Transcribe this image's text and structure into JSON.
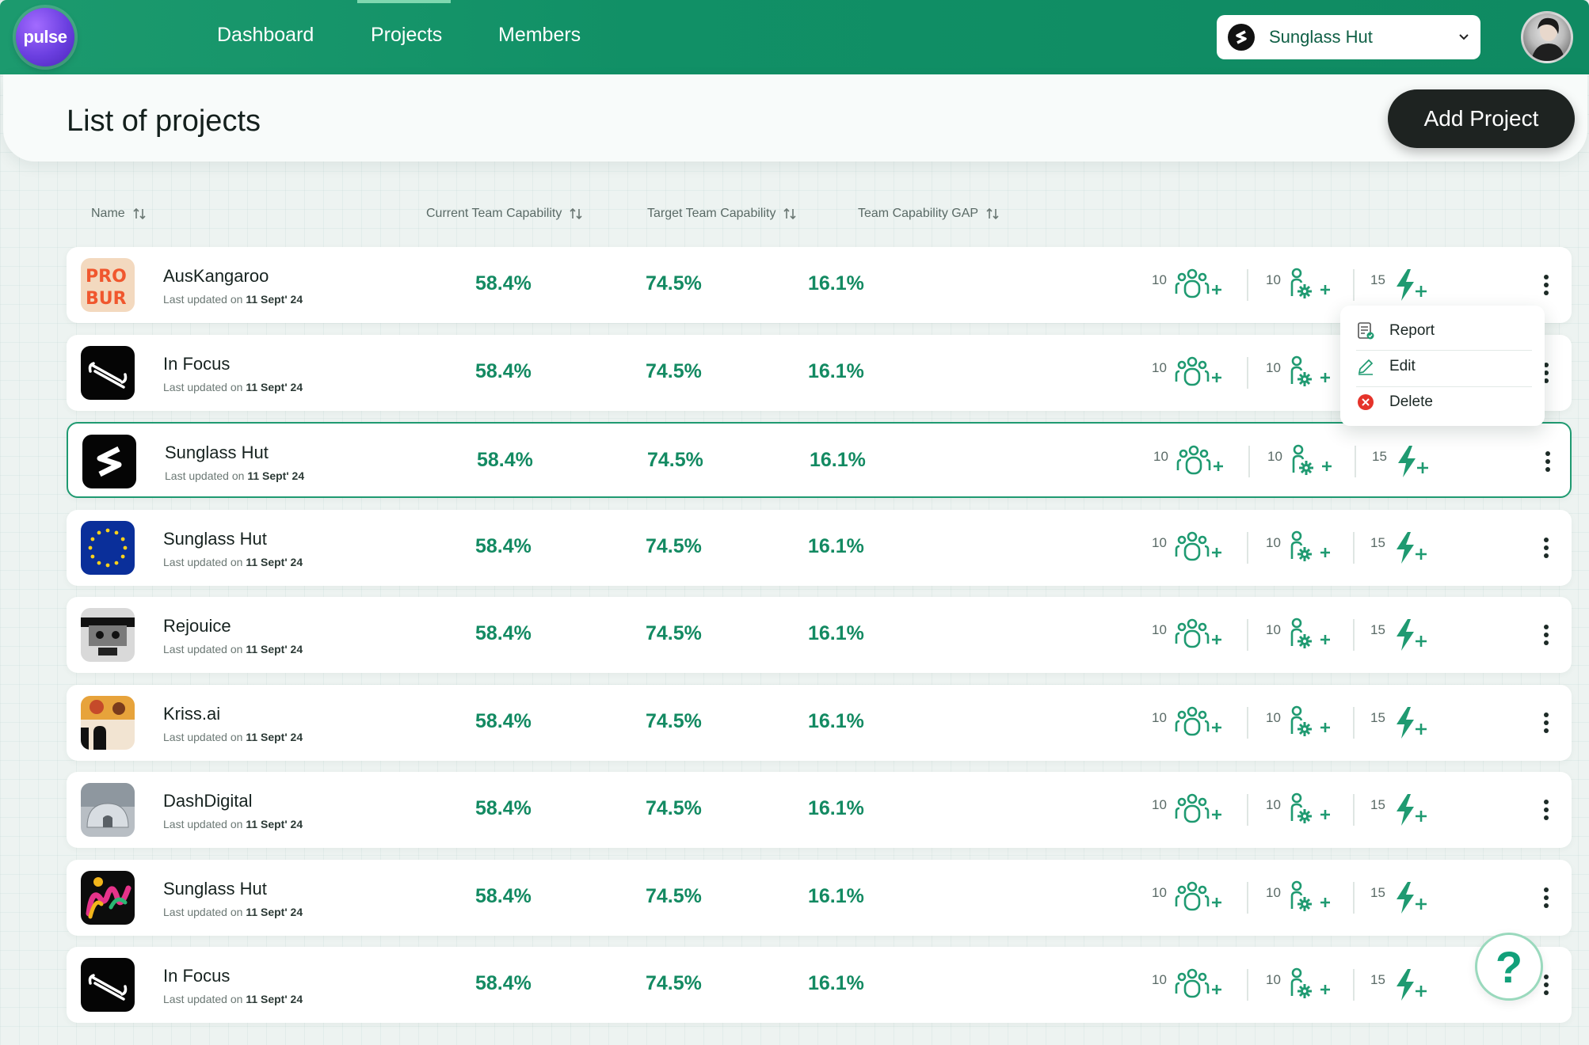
{
  "app": {
    "logo_text": "pulse"
  },
  "nav": {
    "items": [
      {
        "label": "Dashboard"
      },
      {
        "label": "Projects",
        "active": true
      },
      {
        "label": "Members"
      }
    ]
  },
  "org_select": {
    "selected": "Sunglass Hut"
  },
  "page": {
    "title": "List of projects",
    "add_button": "Add Project"
  },
  "columns": {
    "name": "Name",
    "current": "Current Team Capability",
    "target": "Target Team Capability",
    "gap": "Team Capability GAP"
  },
  "colors": {
    "primary": "#138a62",
    "header": "#119066",
    "button_dark": "#1e2321",
    "danger": "#e5332a"
  },
  "rows": [
    {
      "name": "AusKangaroo",
      "updated_prefix": "Last updated on",
      "updated_date": "11 Sept' 24",
      "current": "58.4%",
      "target": "74.5%",
      "gap": "16.1%",
      "members": "10",
      "skills": "10",
      "energy": "15",
      "thumb": "proburn"
    },
    {
      "name": "In Focus",
      "updated_prefix": "Last updated on",
      "updated_date": "11 Sept' 24",
      "current": "58.4%",
      "target": "74.5%",
      "gap": "16.1%",
      "members": "10",
      "skills": "10",
      "energy": "15",
      "thumb": "infocus"
    },
    {
      "name": "Sunglass Hut",
      "updated_prefix": "Last updated on",
      "updated_date": "11 Sept' 24",
      "current": "58.4%",
      "target": "74.5%",
      "gap": "16.1%",
      "members": "10",
      "skills": "10",
      "energy": "15",
      "thumb": "sunglass",
      "selected": true
    },
    {
      "name": "Sunglass Hut",
      "updated_prefix": "Last updated on",
      "updated_date": "11 Sept' 24",
      "current": "58.4%",
      "target": "74.5%",
      "gap": "16.1%",
      "members": "10",
      "skills": "10",
      "energy": "15",
      "thumb": "eu"
    },
    {
      "name": "Rejouice",
      "updated_prefix": "Last updated on",
      "updated_date": "11 Sept' 24",
      "current": "58.4%",
      "target": "74.5%",
      "gap": "16.1%",
      "members": "10",
      "skills": "10",
      "energy": "15",
      "thumb": "rejouice"
    },
    {
      "name": "Kriss.ai",
      "updated_prefix": "Last updated on",
      "updated_date": "11 Sept' 24",
      "current": "58.4%",
      "target": "74.5%",
      "gap": "16.1%",
      "members": "10",
      "skills": "10",
      "energy": "15",
      "thumb": "kriss"
    },
    {
      "name": "DashDigital",
      "updated_prefix": "Last updated on",
      "updated_date": "11 Sept' 24",
      "current": "58.4%",
      "target": "74.5%",
      "gap": "16.1%",
      "members": "10",
      "skills": "10",
      "energy": "15",
      "thumb": "dash"
    },
    {
      "name": "Sunglass Hut",
      "updated_prefix": "Last updated on",
      "updated_date": "11 Sept' 24",
      "current": "58.4%",
      "target": "74.5%",
      "gap": "16.1%",
      "members": "10",
      "skills": "10",
      "energy": "15",
      "thumb": "rainbow"
    },
    {
      "name": "In Focus",
      "updated_prefix": "Last updated on",
      "updated_date": "11 Sept' 24",
      "current": "58.4%",
      "target": "74.5%",
      "gap": "16.1%",
      "members": "10",
      "skills": "10",
      "energy": "15",
      "thumb": "infocus"
    }
  ],
  "menu": {
    "items": [
      {
        "label": "Report",
        "icon": "report-icon"
      },
      {
        "label": "Edit",
        "icon": "edit-icon"
      },
      {
        "label": "Delete",
        "icon": "delete-icon"
      }
    ]
  },
  "help": {
    "label": "?"
  }
}
